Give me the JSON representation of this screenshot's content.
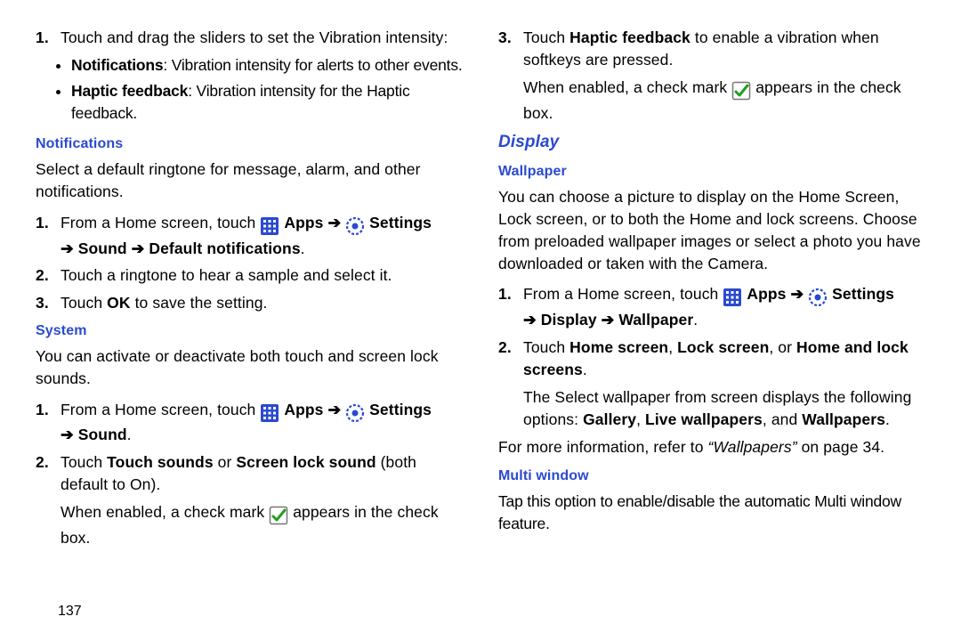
{
  "col1": {
    "step1": {
      "num": "1.",
      "text": "Touch and drag the sliders to set the Vibration intensity:"
    },
    "bullets": {
      "b1": {
        "strong": "Notifications",
        "rest": ": Vibration intensity for alerts to other events."
      },
      "b2": {
        "strong": "Haptic feedback",
        "rest": ": Vibration intensity for the Haptic feedback."
      }
    },
    "notif": {
      "title": "Notifications",
      "intro": "Select a default ringtone for message, alarm, and other notifications.",
      "s1": {
        "num": "1.",
        "pre": "From a Home screen, touch ",
        "apps": "Apps",
        "arrow1": "➔",
        "settings": "Settings",
        "line2arrow": "➔",
        "sound": " Sound ",
        "arrow2": "➔",
        "defn": " Default notifications",
        "dot": "."
      },
      "s2": {
        "num": "2.",
        "text": "Touch a ringtone to hear a sample and select it."
      },
      "s3": {
        "num": "3.",
        "pre": "Touch ",
        "ok": "OK",
        "rest": " to save the setting."
      }
    },
    "system": {
      "title": "System",
      "intro": "You can activate or deactivate both touch and screen lock sounds.",
      "s1": {
        "num": "1.",
        "pre": "From a Home screen, touch ",
        "apps": "Apps",
        "arrow1": "➔",
        "settings": "Settings",
        "line2arrow": "➔",
        "sound": " Sound",
        "dot": "."
      },
      "s2": {
        "num": "2.",
        "pre": "Touch ",
        "ts": "Touch sounds",
        "or": " or ",
        "sls": "Screen lock sound",
        "rest": " (both default to On).",
        "cont1_a": "When enabled, a check mark ",
        "cont1_b": " appears in the check box."
      }
    }
  },
  "col2": {
    "s3": {
      "num": "3.",
      "pre": "Touch ",
      "hf": "Haptic feedback",
      "rest": " to enable a vibration when softkeys are pressed.",
      "cont_a": "When enabled, a check mark ",
      "cont_b": " appears in the check box."
    },
    "display": {
      "title": "Display"
    },
    "wallpaper": {
      "title": "Wallpaper",
      "intro": "You can choose a picture to display on the Home Screen, Lock screen, or to both the Home and lock screens. Choose from preloaded wallpaper images or select a photo you have downloaded or taken with the Camera.",
      "s1": {
        "num": "1.",
        "pre": "From a Home screen, touch ",
        "apps": "Apps",
        "arrow1": "➔",
        "settings": "Settings",
        "line2arrow": "➔",
        "disp": " Display ",
        "arrow2": "➔",
        "wall": " Wallpaper",
        "dot": "."
      },
      "s2": {
        "num": "2.",
        "pre": "Touch ",
        "hs": "Home screen",
        "c1": ", ",
        "ls": "Lock screen",
        "c2": ", or ",
        "hls": "Home and lock screens",
        "dot": ".",
        "cont_a": "The Select wallpaper from screen displays the following options: ",
        "g": "Gallery",
        "c3": ", ",
        "lw": "Live wallpapers",
        "c4": ", and ",
        "wp": "Wallpapers",
        "dot2": "."
      },
      "xref": {
        "a": "For more information, refer to ",
        "q": "“Wallpapers”",
        "b": " on page 34."
      }
    },
    "multi": {
      "title": "Multi window",
      "intro": "Tap this option to enable/disable the automatic Multi window feature."
    }
  },
  "pagenum": "137"
}
